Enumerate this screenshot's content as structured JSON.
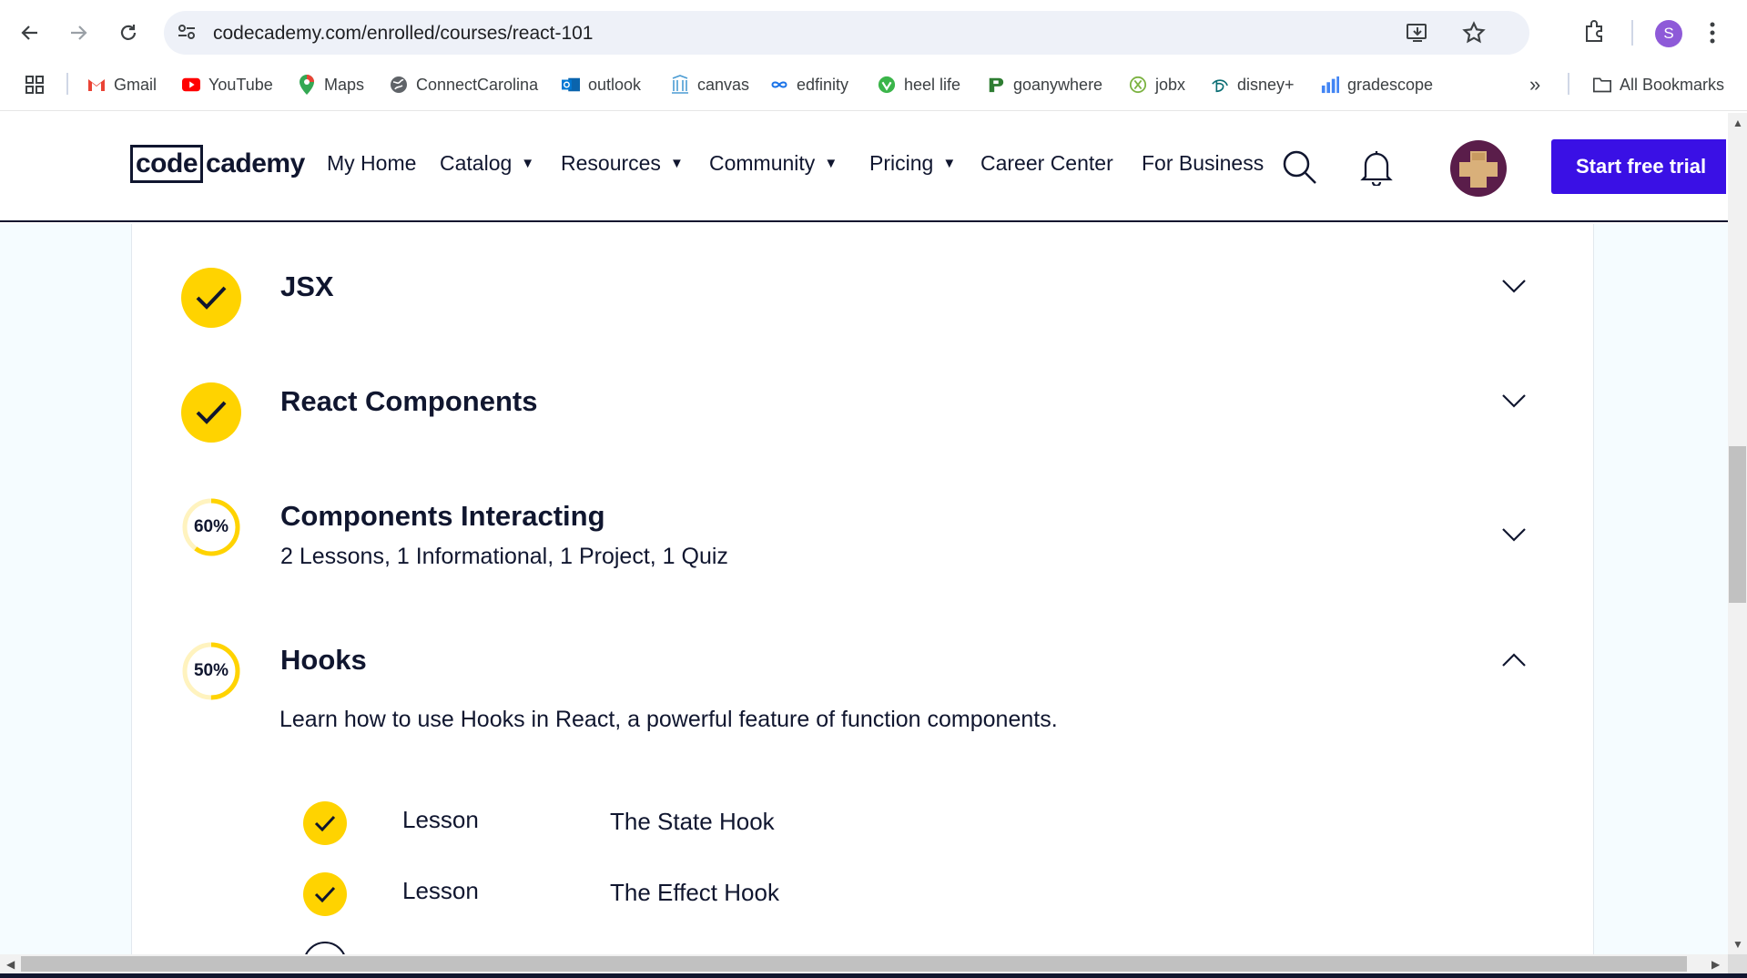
{
  "browser": {
    "url": "codecademy.com/enrolled/courses/react-101",
    "profile_initial": "S",
    "bookmarks": [
      "Gmail",
      "YouTube",
      "Maps",
      "ConnectCarolina",
      "outlook",
      "canvas",
      "edfinity",
      "heel life",
      "goanywhere",
      "jobx",
      "disney+",
      "gradescope"
    ],
    "overflow": "»",
    "all_bookmarks": "All Bookmarks"
  },
  "site": {
    "logo_boxed": "code",
    "logo_rest": "cademy",
    "nav": {
      "my_home": "My Home",
      "catalog": "Catalog",
      "resources": "Resources",
      "community": "Community",
      "pricing": "Pricing",
      "career_center": "Career Center",
      "for_business": "For Business"
    },
    "caret": "▼",
    "cta": "Start free trial",
    "brand_color": "#3a10e5",
    "accent_color": "#ffd300"
  },
  "modules": [
    {
      "title": "JSX",
      "status": "complete"
    },
    {
      "title": "React Components",
      "status": "complete"
    },
    {
      "title": "Components Interacting",
      "progress_label": "60%",
      "progress": 0.6,
      "subtitle": "2 Lessons, 1 Informational, 1 Project, 1 Quiz"
    },
    {
      "title": "Hooks",
      "progress_label": "50%",
      "progress": 0.5,
      "description": "Learn how to use Hooks in React, a powerful feature of function components.",
      "lessons": [
        {
          "type": "Lesson",
          "name": "The State Hook",
          "status": "complete"
        },
        {
          "type": "Lesson",
          "name": "The Effect Hook",
          "status": "complete"
        }
      ]
    }
  ]
}
